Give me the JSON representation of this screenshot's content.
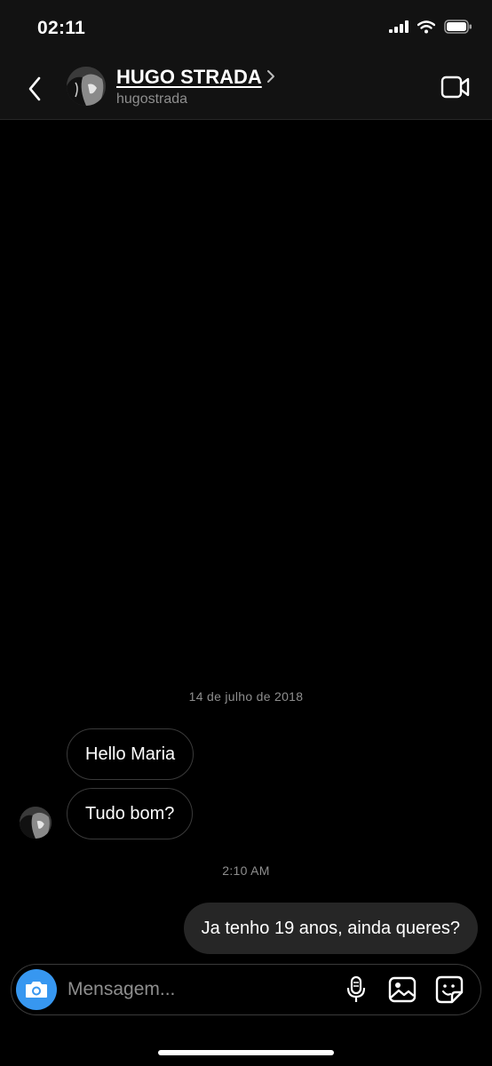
{
  "status_bar": {
    "time": "02:11"
  },
  "header": {
    "name": "HUGO STRADA",
    "username": "hugostrada"
  },
  "conversation": {
    "date_separator": "14 de julho de 2018",
    "incoming": [
      "Hello Maria",
      "Tudo bom?"
    ],
    "time_separator": "2:10 AM",
    "outgoing": [
      "Ja tenho 19 anos, ainda queres?"
    ]
  },
  "composer": {
    "placeholder": "Mensagem..."
  },
  "colors": {
    "accent": "#3797f0",
    "background": "#000000",
    "header_bg": "#121212",
    "outgoing_bubble": "#262626"
  },
  "icons": [
    "signal-icon",
    "wifi-icon",
    "battery-icon",
    "back-chevron-icon",
    "chevron-right-icon",
    "video-camera-icon",
    "camera-icon",
    "microphone-icon",
    "gallery-icon",
    "sticker-icon"
  ]
}
